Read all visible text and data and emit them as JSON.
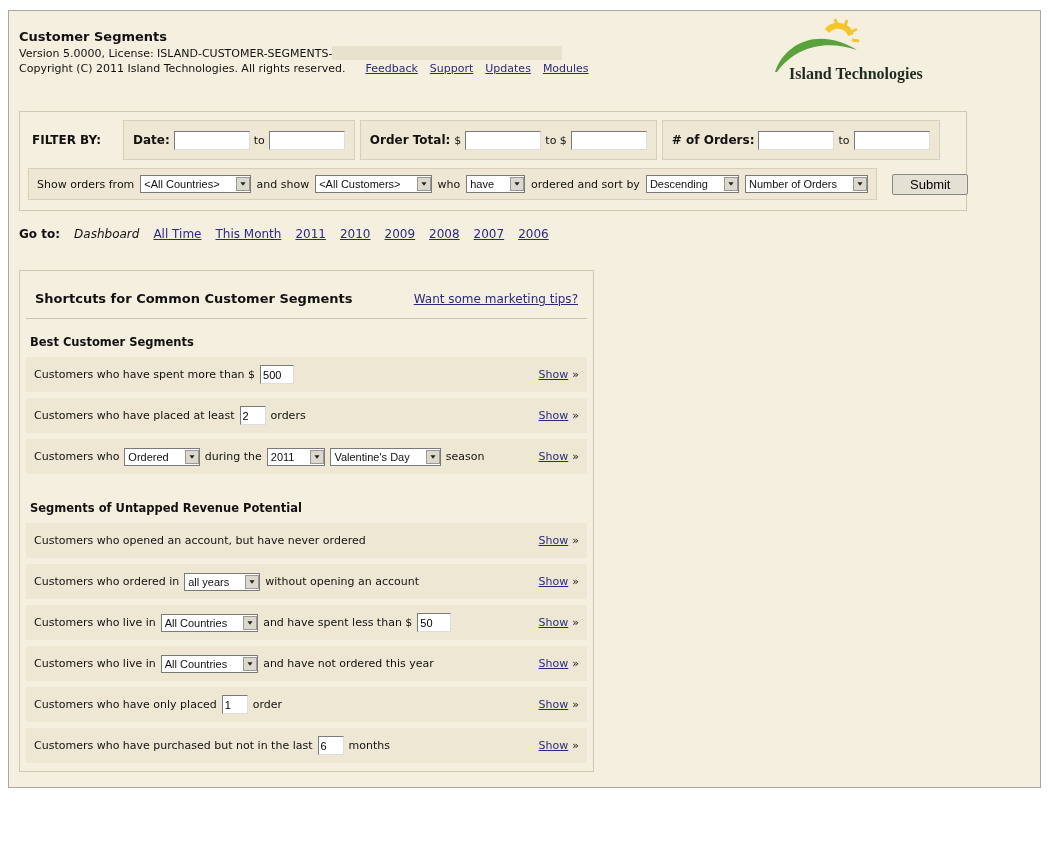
{
  "header": {
    "title": "Customer Segments",
    "version": "Version 5.0000, License: ISLAND-CUSTOMER-SEGMENTS-",
    "copyright": "Copyright (C) 2011 Island Technologies. All rights reserved.",
    "links": [
      "Feedback",
      "Support",
      "Updates",
      "Modules"
    ],
    "logo_text": "Island Technologies"
  },
  "filter": {
    "label": "FILTER BY:",
    "groups": [
      {
        "label": "Date:",
        "parts": [
          {
            "kind": "input"
          },
          {
            "kind": "text",
            "text": "to"
          },
          {
            "kind": "input"
          }
        ]
      },
      {
        "label": "Order Total:",
        "parts": [
          {
            "kind": "text",
            "text": "$"
          },
          {
            "kind": "input"
          },
          {
            "kind": "text",
            "text": "to $"
          },
          {
            "kind": "input"
          }
        ]
      },
      {
        "label": "# of Orders:",
        "parts": [
          {
            "kind": "input"
          },
          {
            "kind": "text",
            "text": "to"
          },
          {
            "kind": "input"
          }
        ]
      }
    ],
    "sentence": [
      {
        "kind": "text",
        "text": "Show orders from"
      },
      {
        "kind": "select",
        "value": "<All Countries>"
      },
      {
        "kind": "text",
        "text": "and show"
      },
      {
        "kind": "select",
        "value": "<All Customers>"
      },
      {
        "kind": "text",
        "text": "who"
      },
      {
        "kind": "select",
        "value": "have"
      },
      {
        "kind": "text",
        "text": "ordered and sort by"
      },
      {
        "kind": "select",
        "value": "Descending"
      },
      {
        "kind": "select",
        "value": "Number of Orders"
      }
    ],
    "submit": "Submit"
  },
  "goto": {
    "label": "Go to:",
    "current": "Dashboard",
    "links": [
      "All Time",
      "This Month",
      "2011",
      "2010",
      "2009",
      "2008",
      "2007",
      "2006"
    ]
  },
  "shortcuts": {
    "title": "Shortcuts for Common Customer Segments",
    "tips_link": "Want some marketing tips?",
    "sections": [
      {
        "heading": "Best Customer Segments",
        "rows": [
          {
            "parts": [
              {
                "kind": "text",
                "text": "Customers who have spent more than $"
              },
              {
                "kind": "input",
                "value": "500"
              }
            ],
            "action": "Show",
            "arrow": "»"
          },
          {
            "parts": [
              {
                "kind": "text",
                "text": "Customers who have placed at least"
              },
              {
                "kind": "input",
                "value": "2"
              },
              {
                "kind": "text",
                "text": "orders"
              }
            ],
            "action": "Show",
            "arrow": "»"
          },
          {
            "parts": [
              {
                "kind": "text",
                "text": "Customers who"
              },
              {
                "kind": "select",
                "value": "Ordered"
              },
              {
                "kind": "text",
                "text": "during the"
              },
              {
                "kind": "select",
                "value": "2011"
              },
              {
                "kind": "select",
                "value": "Valentine's Day"
              },
              {
                "kind": "text",
                "text": "season"
              }
            ],
            "action": "Show",
            "arrow": "»"
          }
        ]
      },
      {
        "heading": "Segments of Untapped Revenue Potential",
        "rows": [
          {
            "parts": [
              {
                "kind": "text",
                "text": "Customers who opened an account, but have never ordered"
              }
            ],
            "action": "Show",
            "arrow": "»"
          },
          {
            "parts": [
              {
                "kind": "text",
                "text": "Customers who ordered in"
              },
              {
                "kind": "select",
                "value": "all years"
              },
              {
                "kind": "text",
                "text": "without opening an account"
              }
            ],
            "action": "Show",
            "arrow": "»"
          },
          {
            "parts": [
              {
                "kind": "text",
                "text": "Customers who live in"
              },
              {
                "kind": "select",
                "value": "All Countries"
              },
              {
                "kind": "text",
                "text": "and have spent less than $"
              },
              {
                "kind": "input",
                "value": "50"
              }
            ],
            "action": "Show",
            "arrow": "»"
          },
          {
            "parts": [
              {
                "kind": "text",
                "text": "Customers who live in"
              },
              {
                "kind": "select",
                "value": "All Countries"
              },
              {
                "kind": "text",
                "text": "and have not ordered this year"
              }
            ],
            "action": "Show",
            "arrow": "»"
          },
          {
            "parts": [
              {
                "kind": "text",
                "text": "Customers who have only placed"
              },
              {
                "kind": "input",
                "value": "1"
              },
              {
                "kind": "text",
                "text": "order"
              }
            ],
            "action": "Show",
            "arrow": "»"
          },
          {
            "parts": [
              {
                "kind": "text",
                "text": "Customers who have purchased but not in the last"
              },
              {
                "kind": "input",
                "value": "6"
              },
              {
                "kind": "text",
                "text": "months"
              }
            ],
            "action": "Show",
            "arrow": "»"
          }
        ]
      }
    ]
  }
}
